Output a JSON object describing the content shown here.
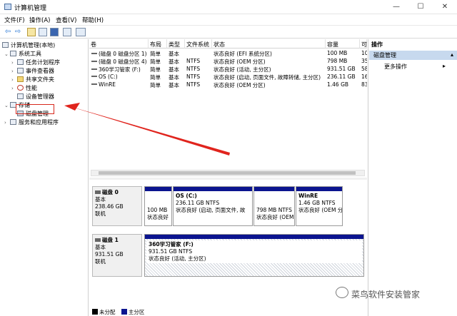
{
  "window": {
    "title": "计算机管理",
    "minimize": "—",
    "maximize": "☐",
    "close": "✕"
  },
  "menu": [
    "文件(F)",
    "操作(A)",
    "查看(V)",
    "帮助(H)"
  ],
  "tree": {
    "root": "计算机管理(本地)",
    "system_tools": "系统工具",
    "task_scheduler": "任务计划程序",
    "event_viewer": "事件查看器",
    "shared_folders": "共享文件夹",
    "performance": "性能",
    "device_manager": "设备管理器",
    "storage": "存储",
    "disk_management": "磁盘管理",
    "services_apps": "服务和应用程序"
  },
  "table": {
    "headers": [
      "卷",
      "布局",
      "类型",
      "文件系统",
      "状态",
      "容量",
      "可"
    ],
    "rows": [
      [
        "(磁盘 0 磁盘分区 1)",
        "简单",
        "基本",
        "",
        "状态良好 (EFI 系统分区)",
        "100 MB",
        "10"
      ],
      [
        "(磁盘 0 磁盘分区 4)",
        "简单",
        "基本",
        "NTFS",
        "状态良好 (OEM 分区)",
        "798 MB",
        "35"
      ],
      [
        "360学习管家 (F:)",
        "简单",
        "基本",
        "NTFS",
        "状态良好 (活动, 主分区)",
        "931.51 GB",
        "58"
      ],
      [
        "OS (C:)",
        "简单",
        "基本",
        "NTFS",
        "状态良好 (启动, 页面文件, 故障转储, 主分区)",
        "236.11 GB",
        "16"
      ],
      [
        "WinRE",
        "简单",
        "基本",
        "NTFS",
        "状态良好 (OEM 分区)",
        "1.46 GB",
        "83"
      ]
    ]
  },
  "disks": [
    {
      "name": "磁盘 0",
      "type": "基本",
      "size": "238.46 GB",
      "status": "联机",
      "partitions": [
        {
          "title": "",
          "size": "100 MB",
          "status": "状态良好"
        },
        {
          "title": "OS  (C:)",
          "size": "236.11 GB NTFS",
          "status": "状态良好 (启动, 页面文件, 故"
        },
        {
          "title": "",
          "size": "798 MB NTFS",
          "status": "状态良好 (OEM"
        },
        {
          "title": "WinRE",
          "size": "1.46 GB NTFS",
          "status": "状态良好 (OEM 分"
        }
      ]
    },
    {
      "name": "磁盘 1",
      "type": "基本",
      "size": "931.51 GB",
      "status": "联机",
      "partitions": [
        {
          "title": "360学习管家  (F:)",
          "size": "931.51 GB NTFS",
          "status": "状态良好 (活动, 主分区)"
        }
      ]
    }
  ],
  "legend": {
    "unallocated": "未分配",
    "primary": "主分区",
    "unallocated_color": "#000000",
    "primary_color": "#0b148f"
  },
  "actions": {
    "header": "操作",
    "selected": "磁盘管理",
    "more": "更多操作"
  },
  "watermark": "菜鸟软件安装管家"
}
